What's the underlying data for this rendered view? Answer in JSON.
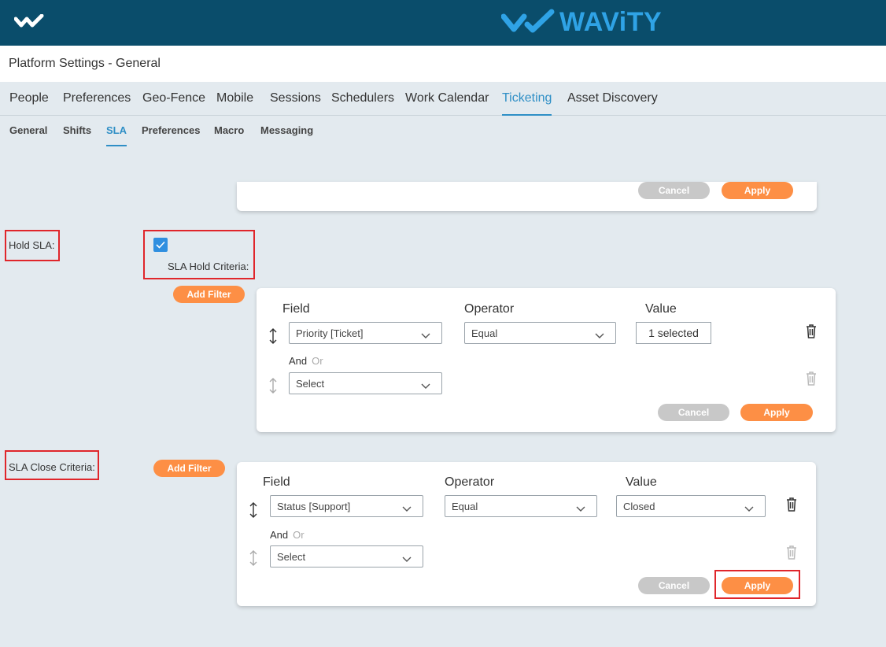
{
  "app": {
    "brand": "WAViTY"
  },
  "page_title": "Platform Settings - General",
  "tabs": [
    {
      "label": "People"
    },
    {
      "label": "Preferences"
    },
    {
      "label": "Geo-Fence"
    },
    {
      "label": "Mobile"
    },
    {
      "label": "Sessions"
    },
    {
      "label": "Schedulers"
    },
    {
      "label": "Work Calendar"
    },
    {
      "label": "Ticketing"
    },
    {
      "label": "Asset Discovery"
    }
  ],
  "active_tab": "Ticketing",
  "subtabs": [
    {
      "label": "General"
    },
    {
      "label": "Shifts"
    },
    {
      "label": "SLA"
    },
    {
      "label": "Preferences"
    },
    {
      "label": "Macro"
    },
    {
      "label": "Messaging"
    }
  ],
  "active_subtab": "SLA",
  "buttons": {
    "cancel": "Cancel",
    "apply": "Apply",
    "add_filter": "Add Filter"
  },
  "hold_sla": {
    "label": "Hold SLA:",
    "checked": true,
    "criteria_label": "SLA Hold Criteria:",
    "filter": {
      "headers": {
        "field": "Field",
        "operator": "Operator",
        "value": "Value"
      },
      "rows": [
        {
          "field": "Priority [Ticket]",
          "operator": "Equal",
          "value": "1 selected"
        }
      ],
      "and_label": "And",
      "or_label": "Or",
      "new_row_placeholder": "Select"
    }
  },
  "close_criteria": {
    "label": "SLA Close Criteria:",
    "filter": {
      "headers": {
        "field": "Field",
        "operator": "Operator",
        "value": "Value"
      },
      "rows": [
        {
          "field": "Status [Support]",
          "operator": "Equal",
          "value": "Closed"
        }
      ],
      "and_label": "And",
      "or_label": "Or",
      "new_row_placeholder": "Select"
    }
  },
  "colors": {
    "header_bg": "#0a4d6b",
    "brand": "#2fa3e6",
    "accent": "#2f8fc6",
    "apply": "#fd8f45",
    "cancel": "#c8c8c8",
    "highlight": "#e0262b"
  }
}
